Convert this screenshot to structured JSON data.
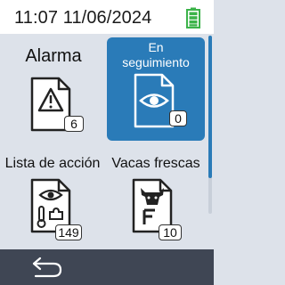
{
  "status": {
    "time_date": "11:07 11/06/2024",
    "battery_icon": "battery-full-icon",
    "battery_color": "#3cb34a"
  },
  "tiles": [
    {
      "label": "Alarma",
      "icon": "warning-document-icon",
      "count": "6"
    },
    {
      "label": "En seguimiento",
      "icon": "eye-document-icon",
      "count": "0",
      "selected": true
    },
    {
      "label": "Lista de acción",
      "icon": "eye-thermometer-puzzle-document-icon",
      "count": "149"
    },
    {
      "label": "Vacas frescas",
      "icon": "cow-fresh-document-icon",
      "count": "10"
    }
  ],
  "nav": {
    "back_icon": "back-arrow-icon"
  },
  "colors": {
    "accent": "#2a7bb8",
    "background": "#dde2ea",
    "bottom_bar": "#3f4654"
  }
}
